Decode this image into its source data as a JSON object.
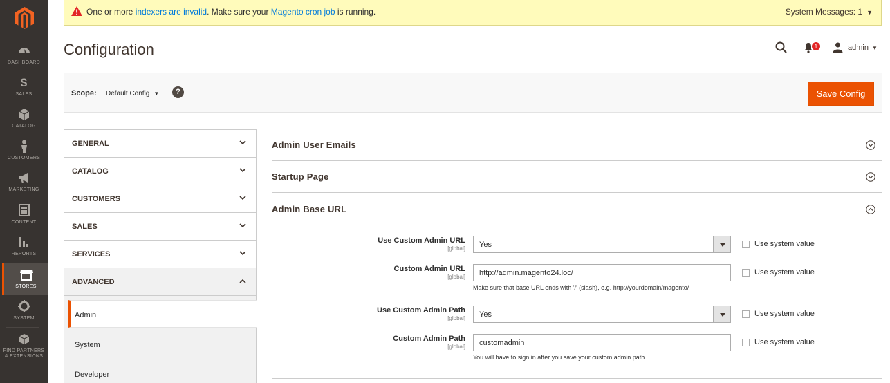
{
  "menu": {
    "items": [
      {
        "label": "DASHBOARD"
      },
      {
        "label": "SALES"
      },
      {
        "label": "CATALOG"
      },
      {
        "label": "CUSTOMERS"
      },
      {
        "label": "MARKETING"
      },
      {
        "label": "CONTENT"
      },
      {
        "label": "REPORTS"
      },
      {
        "label": "STORES"
      },
      {
        "label": "SYSTEM"
      },
      {
        "label": "FIND PARTNERS",
        "label2": "& EXTENSIONS"
      }
    ],
    "active": "STORES"
  },
  "system_message": {
    "text_before": "One or more ",
    "link1": "indexers are invalid",
    "text_middle": ". Make sure your ",
    "link2": "Magento cron job",
    "text_after": " is running.",
    "count_label": "System Messages: 1"
  },
  "header": {
    "title": "Configuration",
    "notification_count": "1",
    "user_name": "admin"
  },
  "scope": {
    "label": "Scope:",
    "value": "Default Config",
    "help": "?",
    "save_label": "Save Config"
  },
  "tabs": [
    {
      "label": "GENERAL"
    },
    {
      "label": "CATALOG"
    },
    {
      "label": "CUSTOMERS"
    },
    {
      "label": "SALES"
    },
    {
      "label": "SERVICES"
    },
    {
      "label": "ADVANCED"
    }
  ],
  "advanced_items": [
    {
      "label": "Admin"
    },
    {
      "label": "System"
    },
    {
      "label": "Developer"
    }
  ],
  "sections": [
    {
      "title": "Admin User Emails"
    },
    {
      "title": "Startup Page"
    },
    {
      "title": "Admin Base URL"
    }
  ],
  "fields": {
    "use_custom_url": {
      "label": "Use Custom Admin URL",
      "scope": "[global]",
      "value": "Yes",
      "system": "Use system value"
    },
    "custom_url": {
      "label": "Custom Admin URL",
      "scope": "[global]",
      "value": "http://admin.magento24.loc/",
      "note": "Make sure that base URL ends with '/' (slash), e.g. http://yourdomain/magento/",
      "system": "Use system value"
    },
    "use_custom_path": {
      "label": "Use Custom Admin Path",
      "scope": "[global]",
      "value": "Yes",
      "system": "Use system value"
    },
    "custom_path": {
      "label": "Custom Admin Path",
      "scope": "[global]",
      "value": "customadmin",
      "note": "You will have to sign in after you save your custom admin path.",
      "system": "Use system value"
    }
  },
  "colors": {
    "accent": "#eb5202",
    "menu_bg": "#373330",
    "message_bg": "#fffbbb",
    "link": "#007bdb"
  }
}
